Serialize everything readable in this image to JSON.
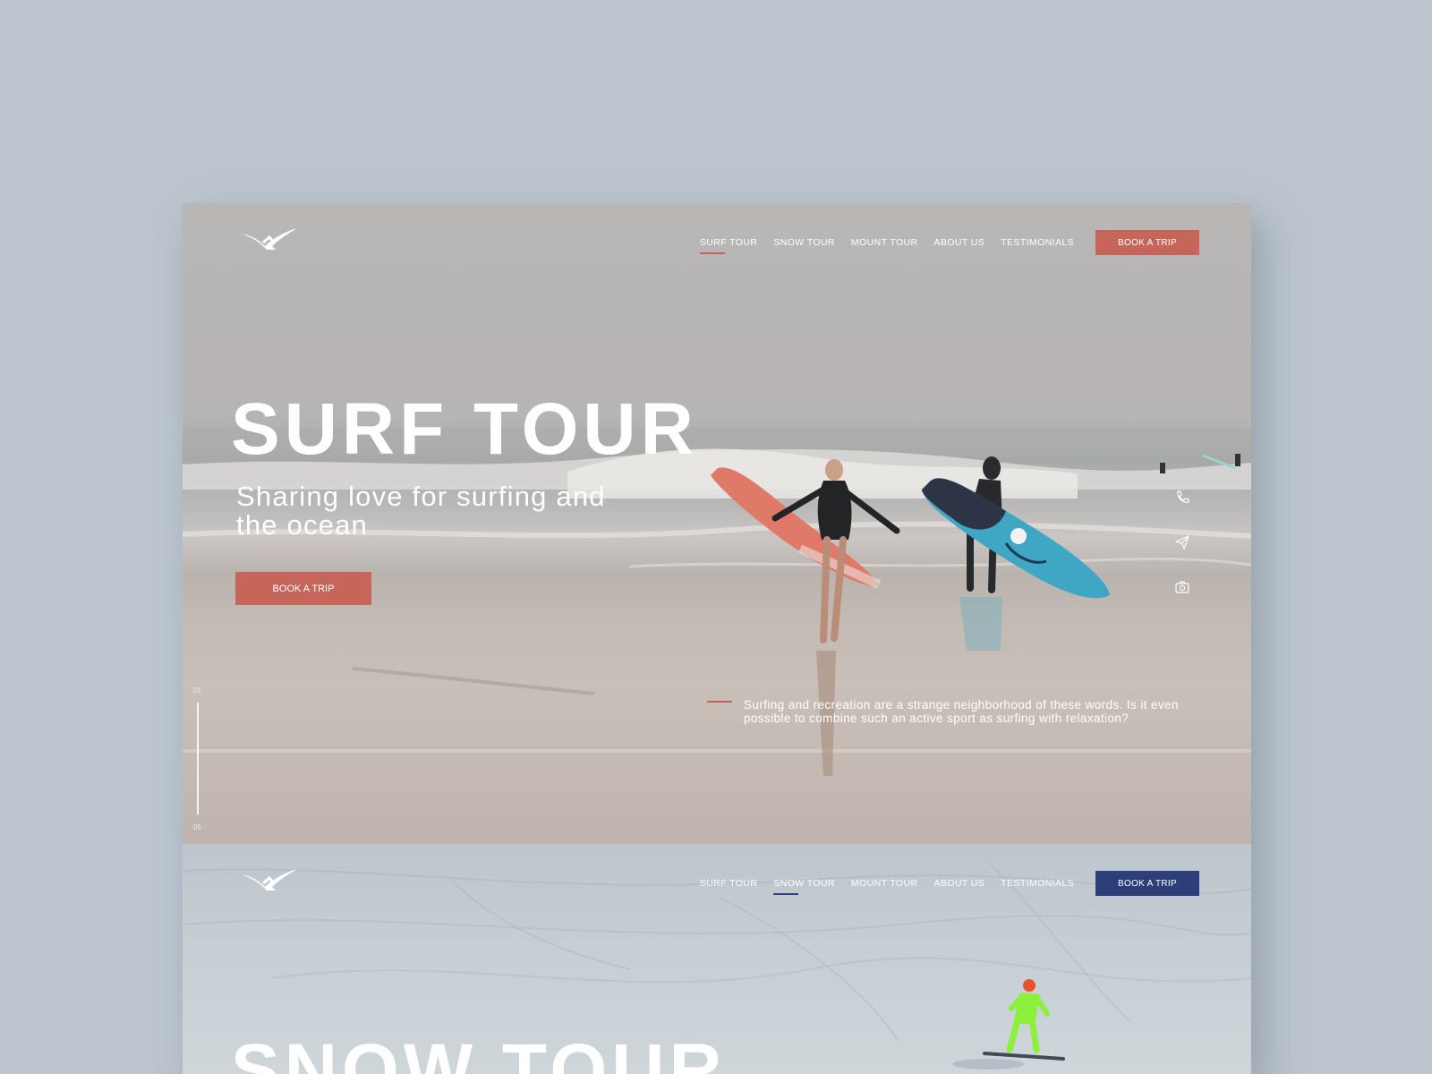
{
  "colors": {
    "background": "#bcc5cd",
    "surf_accent": "#c6665a",
    "snow_accent": "#2d3f79"
  },
  "surf": {
    "nav": {
      "items": [
        "SURF TOUR",
        "SNOW TOUR",
        "MOUNT TOUR",
        "ABOUT US",
        "TESTIMONIALS"
      ],
      "active": "SURF TOUR",
      "book_label": "BOOK A TRIP"
    },
    "hero": {
      "title": "SURF TOUR",
      "subtitle": "Sharing love for surfing and the ocean",
      "cta_label": "BOOK A TRIP"
    },
    "social_icons": [
      "phone-icon",
      "send-icon",
      "camera-icon"
    ],
    "slider": {
      "current": "01",
      "total": "05"
    },
    "quote": "Surfing and recreation are a strange neighborhood of these words. Is it even possible to combine such an active sport as surfing with relaxation?"
  },
  "snow": {
    "nav": {
      "items": [
        "SURF TOUR",
        "SNOW TOUR",
        "MOUNT TOUR",
        "ABOUT US",
        "TESTIMONIALS"
      ],
      "active": "SNOW TOUR",
      "book_label": "BOOK A TRIP"
    },
    "hero": {
      "title": "SNOW TOUR"
    }
  }
}
